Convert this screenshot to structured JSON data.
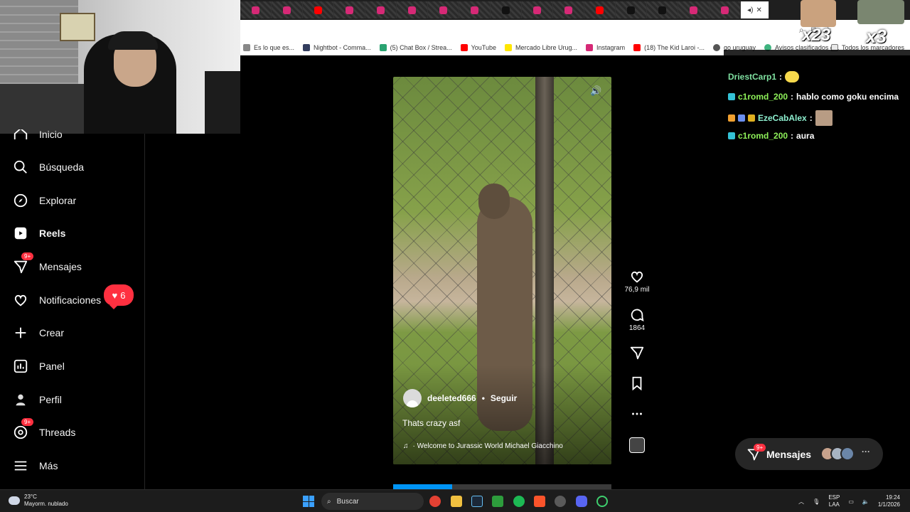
{
  "browser": {
    "bookmarks": [
      {
        "label": "Es lo que es...",
        "color": "#888888"
      },
      {
        "label": "Nightbot - Comma...",
        "color": "#333d5e"
      },
      {
        "label": "(5) Chat Box / Strea...",
        "color": "#2aa371"
      },
      {
        "label": "YouTube",
        "color": "#ff0000"
      },
      {
        "label": "Mercado Libre Urug...",
        "color": "#ffe600"
      },
      {
        "label": "Instagram",
        "color": "#d62976"
      },
      {
        "label": "(18) The Kid Laroi -...",
        "color": "#ff0000"
      },
      {
        "label": "go uruguay",
        "color": "#555555"
      },
      {
        "label": "Avisos clasificados g...",
        "color": "#3fb37f"
      }
    ],
    "bookmarks_right": "Todos los marcadores"
  },
  "overlay": {
    "emote1_count": "x23",
    "emote2_count": "x3"
  },
  "sidebar": {
    "items": [
      {
        "label": "Inicio",
        "icon": "home-icon"
      },
      {
        "label": "Búsqueda",
        "icon": "search-icon"
      },
      {
        "label": "Explorar",
        "icon": "compass-icon"
      },
      {
        "label": "Reels",
        "icon": "reels-icon"
      },
      {
        "label": "Mensajes",
        "icon": "messenger-icon",
        "badge": "9+"
      },
      {
        "label": "Notificaciones",
        "icon": "heart-icon"
      },
      {
        "label": "Crear",
        "icon": "plus-icon"
      },
      {
        "label": "Panel",
        "icon": "chart-icon"
      },
      {
        "label": "Perfil",
        "icon": "profile-icon"
      },
      {
        "label": "Threads",
        "icon": "threads-icon",
        "badge": "9+"
      },
      {
        "label": "Más",
        "icon": "menu-icon"
      }
    ],
    "notifications_count": "6"
  },
  "reel": {
    "username": "deeleted666",
    "separator": "•",
    "follow": "Seguir",
    "caption": "Thats crazy asf",
    "audio": "· Welcome to Jurassic World   Michael Giacchino",
    "likes": "76,9 mil",
    "comments": "1864",
    "progress": 0.27
  },
  "chat": {
    "lines": [
      {
        "user": "DriestCarp1",
        "msg": "",
        "color": "#7fe0a0"
      },
      {
        "user": "c1romd_200",
        "msg": "hablo como goku encima",
        "color": "#8ff25a"
      },
      {
        "user": "EzeCabAlex",
        "msg": "",
        "color": "#8ef0d0"
      },
      {
        "user": "c1romd_200",
        "msg": "aura",
        "color": "#8ff25a"
      }
    ]
  },
  "messages_pill": {
    "label": "Mensajes",
    "badge": "9+",
    "more": "···"
  },
  "taskbar": {
    "temp": "23°C",
    "weather": "Mayorm. nublado",
    "search": "Buscar",
    "lang1": "ESP",
    "lang2": "LAA",
    "time": "19:24",
    "date": "1/1/2026"
  }
}
